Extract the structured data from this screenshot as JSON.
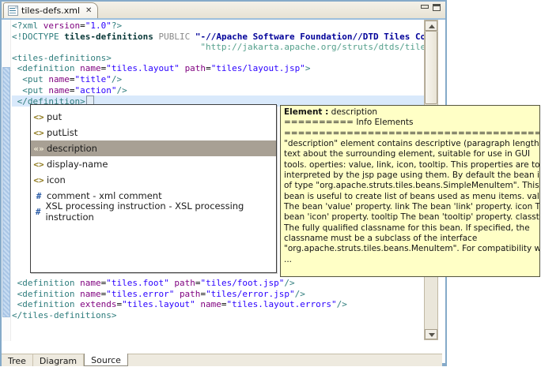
{
  "colors": {
    "view_border": "#85aac9",
    "current_line_highlight": "#d9e9fb",
    "selection_bg": "#a8a094",
    "tooltip_bg": "#ffffc6",
    "tag_teal": "#2f7d7d",
    "attr_purple": "#7f007f",
    "value_blue": "#2a00ff"
  },
  "tab": {
    "title": "tiles-defs.xml",
    "close_glyph": "✕"
  },
  "editor": {
    "top_lines": [
      {
        "tokens": [
          [
            "<?xml ",
            "tag"
          ],
          [
            "version",
            "attr"
          ],
          [
            "=",
            "plain"
          ],
          [
            "\"1.0\"",
            "val"
          ],
          [
            "?>",
            "tag"
          ]
        ]
      },
      {
        "tokens": [
          [
            "<!DOCTYPE ",
            "tag"
          ],
          [
            "tiles-definitions",
            "dtname"
          ],
          [
            " ",
            "plain"
          ],
          [
            "PUBLIC",
            "kw"
          ],
          [
            " ",
            "plain"
          ],
          [
            "\"-//Apache Software Foundation//DTD Tiles Conf",
            "pubid"
          ]
        ]
      },
      {
        "tokens": [
          [
            "                                    ",
            "plain"
          ],
          [
            "\"http://jakarta.apache.org/struts/dtds/tiles-c",
            "sysid"
          ]
        ]
      },
      {
        "tokens": [
          [
            "<tiles-definitions>",
            "tag"
          ]
        ]
      },
      {
        "tokens": [
          [
            " <definition ",
            "tag"
          ],
          [
            "name",
            "attr"
          ],
          [
            "=",
            "plain"
          ],
          [
            "\"tiles.layout\"",
            "val"
          ],
          [
            " ",
            "plain"
          ],
          [
            "path",
            "attr"
          ],
          [
            "=",
            "plain"
          ],
          [
            "\"tiles/layout.jsp\"",
            "val"
          ],
          [
            ">",
            "tag"
          ]
        ]
      },
      {
        "tokens": [
          [
            "  <put ",
            "tag"
          ],
          [
            "name",
            "attr"
          ],
          [
            "=",
            "plain"
          ],
          [
            "\"title\"",
            "val"
          ],
          [
            "/>",
            "tag"
          ]
        ]
      },
      {
        "tokens": [
          [
            "  <put ",
            "tag"
          ],
          [
            "name",
            "attr"
          ],
          [
            "=",
            "plain"
          ],
          [
            "\"action\"",
            "val"
          ],
          [
            "/>",
            "tag"
          ]
        ]
      },
      {
        "tokens": [
          [
            " </definition>",
            "tag"
          ]
        ],
        "highlight": true,
        "caret": true
      }
    ],
    "bottom_lines": [
      {
        "tokens": [
          [
            " <definition ",
            "tag"
          ],
          [
            "name",
            "attr"
          ],
          [
            "=",
            "plain"
          ],
          [
            "\"tiles.foot\"",
            "val"
          ],
          [
            " ",
            "plain"
          ],
          [
            "path",
            "attr"
          ],
          [
            "=",
            "plain"
          ],
          [
            "\"tiles/foot.jsp\"",
            "val"
          ],
          [
            "/>",
            "tag"
          ]
        ]
      },
      {
        "tokens": [
          [
            " <definition ",
            "tag"
          ],
          [
            "name",
            "attr"
          ],
          [
            "=",
            "plain"
          ],
          [
            "\"tiles.error\"",
            "val"
          ],
          [
            " ",
            "plain"
          ],
          [
            "path",
            "attr"
          ],
          [
            "=",
            "plain"
          ],
          [
            "\"tiles/error.jsp\"",
            "val"
          ],
          [
            "/>",
            "tag"
          ]
        ]
      },
      {
        "tokens": [
          [
            " <definition ",
            "tag"
          ],
          [
            "extends",
            "attr"
          ],
          [
            "=",
            "plain"
          ],
          [
            "\"tiles.layout\"",
            "val"
          ],
          [
            " ",
            "plain"
          ],
          [
            "name",
            "attr"
          ],
          [
            "=",
            "plain"
          ],
          [
            "\"tiles.layout.errors\"",
            "val"
          ],
          [
            "/>",
            "tag"
          ]
        ]
      },
      {
        "tokens": [
          [
            "</tiles-definitions>",
            "tag"
          ]
        ]
      }
    ]
  },
  "completion": {
    "items": [
      {
        "icon": "element",
        "glyph": "<>",
        "label": "put",
        "selected": false
      },
      {
        "icon": "element",
        "glyph": "<>",
        "label": "putList",
        "selected": false
      },
      {
        "icon": "element",
        "glyph": "«»",
        "label": "description",
        "selected": true
      },
      {
        "icon": "element",
        "glyph": "<>",
        "label": "display-name",
        "selected": false
      },
      {
        "icon": "element",
        "glyph": "<>",
        "label": "icon",
        "selected": false
      },
      {
        "icon": "template",
        "glyph": "#",
        "label": "comment - xml comment",
        "selected": false
      },
      {
        "icon": "template",
        "glyph": "#",
        "label": "XSL processing instruction - XSL processing instruction",
        "selected": false
      }
    ]
  },
  "tooltip": {
    "title_bold": "Element :",
    "title_rest": " description",
    "lines": [
      "========== Info Elements",
      "===================================== The",
      "\"description\" element contains descriptive (paragraph length)",
      "text about the surrounding element, suitable for use in GUI",
      "tools. operties: value, link, icon, tooltip. This properties are to be",
      "interpreted by the jsp page using them. By default the bean is",
      "of type \"org.apache.struts.tiles.beans.SimpleMenuItem\". This",
      "bean is useful to create list of beans used as menu items. value",
      "The bean 'value' property. link The bean 'link' property. icon The",
      "bean 'icon' property. tooltip The bean 'tooltip' property. classtype",
      "The fully qualified classname for this bean. If specified, the",
      "classname must be a subclass of the interface",
      "\"org.apache.struts.tiles.beans.MenuItem\". For compatibility with",
      "..."
    ]
  },
  "bottom_tabs": {
    "items": [
      {
        "label": "Tree",
        "active": false
      },
      {
        "label": "Diagram",
        "active": false
      },
      {
        "label": "Source",
        "active": true
      }
    ]
  }
}
